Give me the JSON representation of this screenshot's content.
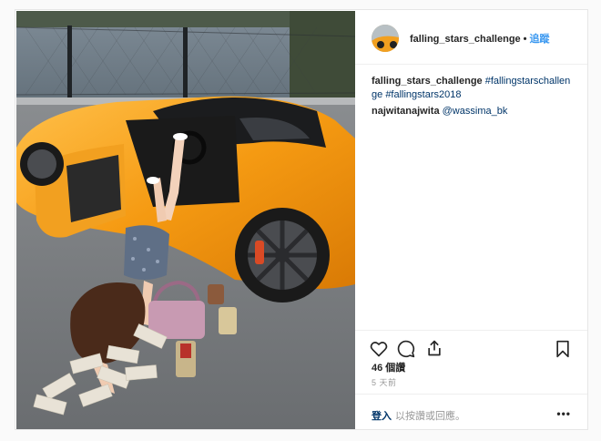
{
  "header": {
    "username": "falling_stars_challenge",
    "separator": "•",
    "follow_label": "追蹤"
  },
  "caption": {
    "username": "falling_stars_challenge",
    "hashtag_1": "#fallingstarschallenge",
    "hashtag_2": "#fallingstars2018"
  },
  "comment": {
    "username": "najwitanajwita",
    "mention": "@wassima_bk"
  },
  "actions": {
    "icons": [
      "heart-icon",
      "comment-icon",
      "share-icon",
      "bookmark-icon"
    ]
  },
  "likes_label": "46 個讚",
  "time_label": "5 天前",
  "comment_box": {
    "login_label": "登入",
    "prompt": "以按讚或回應。",
    "more": "•••"
  },
  "colors": {
    "link": "#003569",
    "follow": "#3897f0",
    "car": "#f7a21b",
    "muted": "#999999"
  }
}
